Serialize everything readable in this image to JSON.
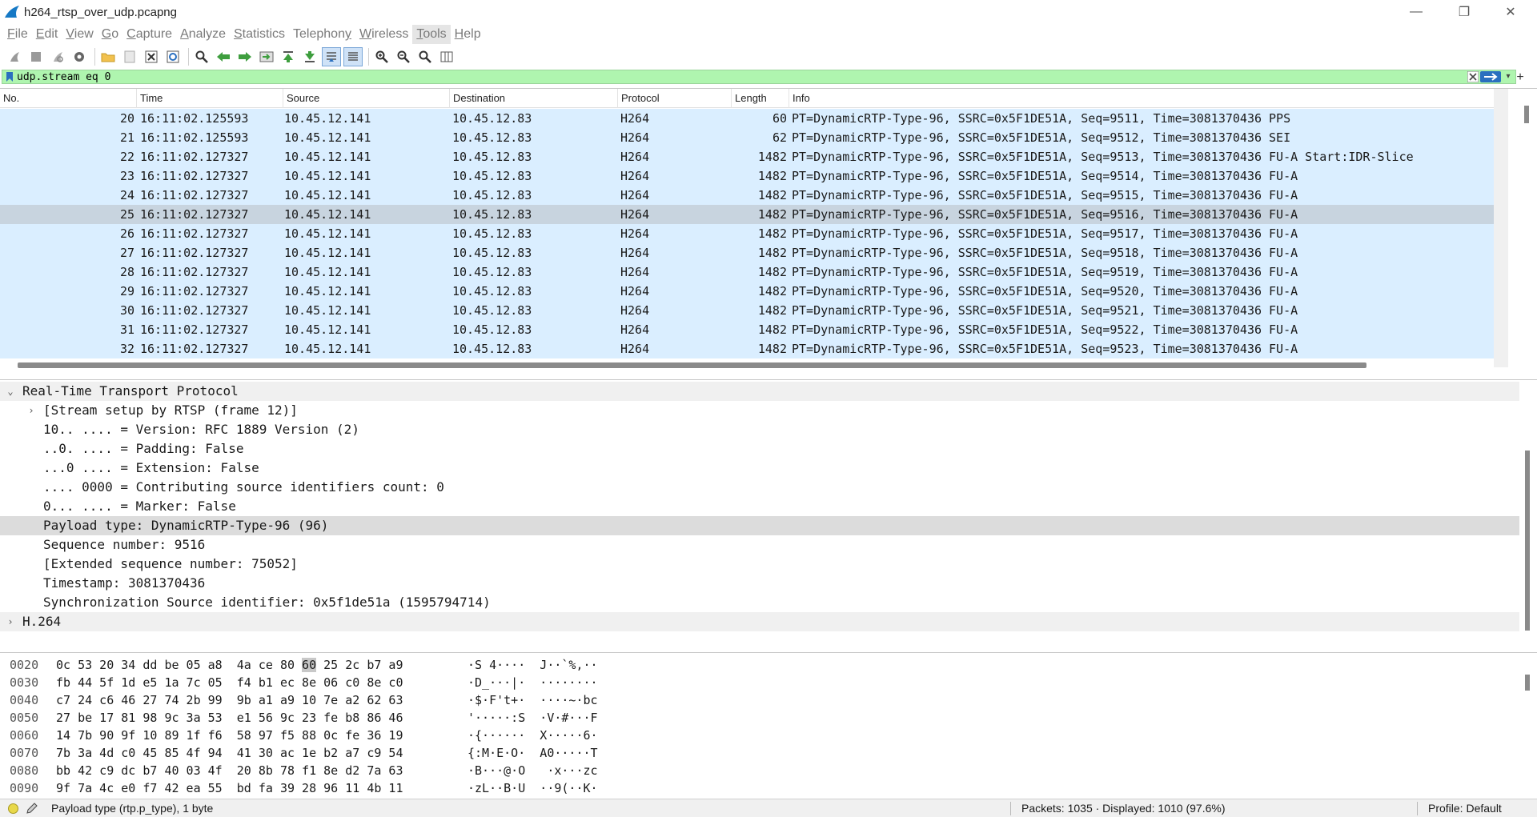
{
  "window": {
    "title": "h264_rtsp_over_udp.pcapng",
    "minimize_glyph": "—",
    "maximize_glyph": "❐",
    "close_glyph": "✕"
  },
  "menu": {
    "items": [
      {
        "label": "File",
        "ul": "F",
        "rest": "ile"
      },
      {
        "label": "Edit",
        "ul": "E",
        "rest": "dit"
      },
      {
        "label": "View",
        "ul": "V",
        "rest": "iew"
      },
      {
        "label": "Go",
        "ul": "G",
        "rest": "o"
      },
      {
        "label": "Capture",
        "ul": "C",
        "rest": "apture"
      },
      {
        "label": "Analyze",
        "ul": "A",
        "rest": "nalyze"
      },
      {
        "label": "Statistics",
        "ul": "S",
        "rest": "tatistics"
      },
      {
        "label": "Telephony",
        "ul": "y",
        "rest": "Telephon"
      },
      {
        "label": "Wireless",
        "ul": "W",
        "rest": "ireless"
      },
      {
        "label": "Tools",
        "ul": "T",
        "rest": "ools"
      },
      {
        "label": "Help",
        "ul": "H",
        "rest": "elp"
      }
    ]
  },
  "filter": {
    "value": "udp.stream eq 0",
    "add_glyph": "+",
    "dropdown_glyph": "▾"
  },
  "packet_list": {
    "columns": [
      "No.",
      "Time",
      "Source",
      "Destination",
      "Protocol",
      "Length",
      "Info"
    ],
    "rows": [
      {
        "no": "20",
        "time": "16:11:02.125593",
        "src": "10.45.12.141",
        "dst": "10.45.12.83",
        "proto": "H264",
        "len": "60",
        "info": "PT=DynamicRTP-Type-96, SSRC=0x5F1DE51A, Seq=9511, Time=3081370436 PPS"
      },
      {
        "no": "21",
        "time": "16:11:02.125593",
        "src": "10.45.12.141",
        "dst": "10.45.12.83",
        "proto": "H264",
        "len": "62",
        "info": "PT=DynamicRTP-Type-96, SSRC=0x5F1DE51A, Seq=9512, Time=3081370436 SEI"
      },
      {
        "no": "22",
        "time": "16:11:02.127327",
        "src": "10.45.12.141",
        "dst": "10.45.12.83",
        "proto": "H264",
        "len": "1482",
        "info": "PT=DynamicRTP-Type-96, SSRC=0x5F1DE51A, Seq=9513, Time=3081370436 FU-A Start:IDR-Slice"
      },
      {
        "no": "23",
        "time": "16:11:02.127327",
        "src": "10.45.12.141",
        "dst": "10.45.12.83",
        "proto": "H264",
        "len": "1482",
        "info": "PT=DynamicRTP-Type-96, SSRC=0x5F1DE51A, Seq=9514, Time=3081370436 FU-A"
      },
      {
        "no": "24",
        "time": "16:11:02.127327",
        "src": "10.45.12.141",
        "dst": "10.45.12.83",
        "proto": "H264",
        "len": "1482",
        "info": "PT=DynamicRTP-Type-96, SSRC=0x5F1DE51A, Seq=9515, Time=3081370436 FU-A"
      },
      {
        "no": "25",
        "time": "16:11:02.127327",
        "src": "10.45.12.141",
        "dst": "10.45.12.83",
        "proto": "H264",
        "len": "1482",
        "info": "PT=DynamicRTP-Type-96, SSRC=0x5F1DE51A, Seq=9516, Time=3081370436 FU-A",
        "selected": true
      },
      {
        "no": "26",
        "time": "16:11:02.127327",
        "src": "10.45.12.141",
        "dst": "10.45.12.83",
        "proto": "H264",
        "len": "1482",
        "info": "PT=DynamicRTP-Type-96, SSRC=0x5F1DE51A, Seq=9517, Time=3081370436 FU-A"
      },
      {
        "no": "27",
        "time": "16:11:02.127327",
        "src": "10.45.12.141",
        "dst": "10.45.12.83",
        "proto": "H264",
        "len": "1482",
        "info": "PT=DynamicRTP-Type-96, SSRC=0x5F1DE51A, Seq=9518, Time=3081370436 FU-A"
      },
      {
        "no": "28",
        "time": "16:11:02.127327",
        "src": "10.45.12.141",
        "dst": "10.45.12.83",
        "proto": "H264",
        "len": "1482",
        "info": "PT=DynamicRTP-Type-96, SSRC=0x5F1DE51A, Seq=9519, Time=3081370436 FU-A"
      },
      {
        "no": "29",
        "time": "16:11:02.127327",
        "src": "10.45.12.141",
        "dst": "10.45.12.83",
        "proto": "H264",
        "len": "1482",
        "info": "PT=DynamicRTP-Type-96, SSRC=0x5F1DE51A, Seq=9520, Time=3081370436 FU-A"
      },
      {
        "no": "30",
        "time": "16:11:02.127327",
        "src": "10.45.12.141",
        "dst": "10.45.12.83",
        "proto": "H264",
        "len": "1482",
        "info": "PT=DynamicRTP-Type-96, SSRC=0x5F1DE51A, Seq=9521, Time=3081370436 FU-A"
      },
      {
        "no": "31",
        "time": "16:11:02.127327",
        "src": "10.45.12.141",
        "dst": "10.45.12.83",
        "proto": "H264",
        "len": "1482",
        "info": "PT=DynamicRTP-Type-96, SSRC=0x5F1DE51A, Seq=9522, Time=3081370436 FU-A"
      },
      {
        "no": "32",
        "time": "16:11:02.127327",
        "src": "10.45.12.141",
        "dst": "10.45.12.83",
        "proto": "H264",
        "len": "1482",
        "info": "PT=DynamicRTP-Type-96, SSRC=0x5F1DE51A, Seq=9523, Time=3081370436 FU-A"
      }
    ]
  },
  "details": {
    "rows": [
      {
        "text": "Real-Time Transport Protocol",
        "level": 0,
        "expander": "v",
        "head": true
      },
      {
        "text": "[Stream setup by RTSP (frame 12)]",
        "level": 1,
        "expander": ">"
      },
      {
        "text": "10.. .... = Version: RFC 1889 Version (2)",
        "level": 1
      },
      {
        "text": "..0. .... = Padding: False",
        "level": 1
      },
      {
        "text": "...0 .... = Extension: False",
        "level": 1
      },
      {
        "text": ".... 0000 = Contributing source identifiers count: 0",
        "level": 1
      },
      {
        "text": "0... .... = Marker: False",
        "level": 1
      },
      {
        "text": "Payload type: DynamicRTP-Type-96 (96)",
        "level": 1,
        "selected": true
      },
      {
        "text": "Sequence number: 9516",
        "level": 1
      },
      {
        "text": "[Extended sequence number: 75052]",
        "level": 1
      },
      {
        "text": "Timestamp: 3081370436",
        "level": 1
      },
      {
        "text": "Synchronization Source identifier: 0x5f1de51a (1595794714)",
        "level": 1
      },
      {
        "text": "H.264",
        "level": 0,
        "expander": ">",
        "head": true
      }
    ]
  },
  "hex": {
    "rows": [
      {
        "off": "0020",
        "hex": "0c 53 20 34 dd be 05 a8  4a ce 80 60 25 2c b7 a9",
        "ascii": "·S 4····  J··`%,··"
      },
      {
        "off": "0030",
        "hex": "fb 44 5f 1d e5 1a 7c 05  f4 b1 ec 8e 06 c0 8e c0",
        "ascii": "·D_···|·  ········"
      },
      {
        "off": "0040",
        "hex": "c7 24 c6 46 27 74 2b 99  9b a1 a9 10 7e a2 62 63",
        "ascii": "·$·F't+·  ····~·bc"
      },
      {
        "off": "0050",
        "hex": "27 be 17 81 98 9c 3a 53  e1 56 9c 23 fe b8 86 46",
        "ascii": "'·····:S  ·V·#···F"
      },
      {
        "off": "0060",
        "hex": "14 7b 90 9f 10 89 1f f6  58 97 f5 88 0c fe 36 19",
        "ascii": "·{······  X·····6·"
      },
      {
        "off": "0070",
        "hex": "7b 3a 4d c0 45 85 4f 94  41 30 ac 1e b2 a7 c9 54",
        "ascii": "{:M·E·O·  A0·····T"
      },
      {
        "off": "0080",
        "hex": "bb 42 c9 dc b7 40 03 4f  20 8b 78 f1 8e d2 7a 63",
        "ascii": "·B···@·O   ·x···zc"
      },
      {
        "off": "0090",
        "hex": "9f 7a 4c e0 f7 42 ea 55  bd fa 39 28 96 11 4b 11",
        "ascii": "·zL··B·U  ··9(··K·"
      }
    ]
  },
  "status": {
    "field_info": "Payload type (rtp.p_type), 1 byte",
    "packets": "Packets: 1035 · Displayed: 1010 (97.6%)",
    "profile": "Profile: Default"
  },
  "colors": {
    "row_bg": "#daeeff",
    "row_selected": "#c8d4df",
    "filter_bg": "#aff5af"
  }
}
